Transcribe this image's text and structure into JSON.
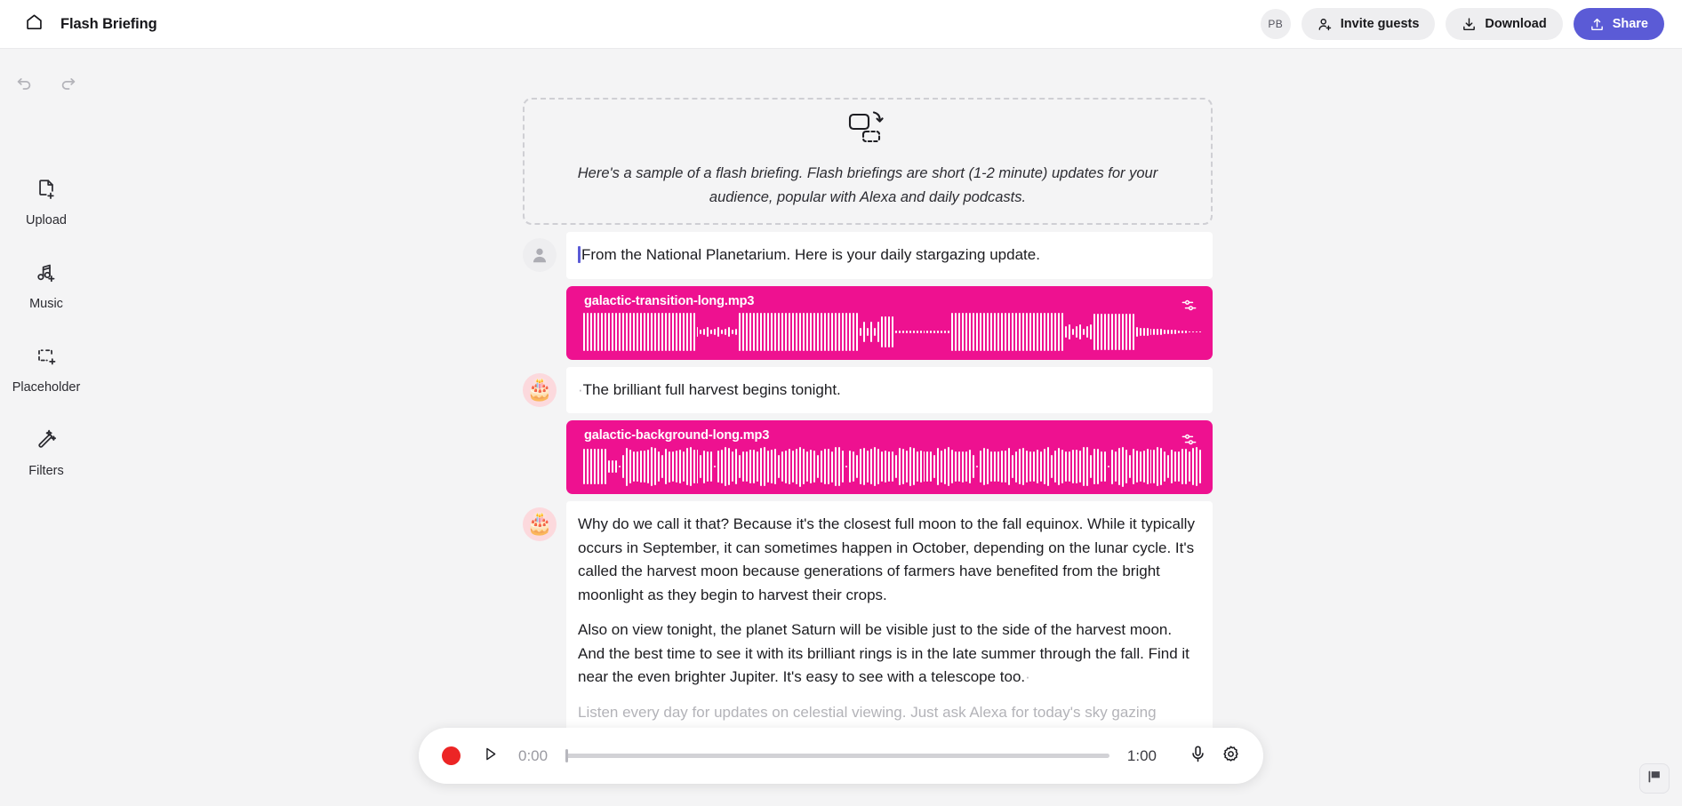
{
  "header": {
    "home_icon": "home-icon",
    "title": "Flash Briefing",
    "avatar_initials": "PB",
    "invite_label": "Invite guests",
    "download_label": "Download",
    "share_label": "Share",
    "accent_purple": "#5b5bd6"
  },
  "sidebar": {
    "undo_icon": "undo-icon",
    "redo_icon": "redo-icon",
    "items": [
      {
        "icon": "file-plus-icon",
        "label": "Upload"
      },
      {
        "icon": "music-note-plus-icon",
        "label": "Music"
      },
      {
        "icon": "dashed-box-plus-icon",
        "label": "Placeholder"
      },
      {
        "icon": "magic-wand-icon",
        "label": "Filters"
      }
    ]
  },
  "sample_card": {
    "icon": "duplicate-arrow-icon",
    "text": "Here's a sample of a flash briefing. Flash briefings are short (1-2 minute) updates for your audience, popular with Alexa and daily podcasts."
  },
  "transcript": {
    "row1": {
      "avatar": "person-avatar",
      "text": "From the National Planetarium. Here is your daily stargazing update."
    },
    "track1": {
      "name": "galactic-transition-long.mp3",
      "settings_icon": "sliders-icon",
      "color": "#ee1190"
    },
    "row2": {
      "avatar": "birthday-cake-emoji",
      "emoji": "🎂",
      "text": "The brilliant full harvest begins tonight."
    },
    "track2": {
      "name": "galactic-background-long.mp3",
      "settings_icon": "sliders-icon",
      "color": "#ee1190"
    },
    "row3": {
      "avatar": "birthday-cake-emoji",
      "emoji": "🎂",
      "paragraph1": "Why do we call it that? Because it's the closest full moon to the fall equinox. While it typically occurs in September, it can sometimes happen in October, depending on the lunar cycle. It's called the harvest moon because generations of farmers have benefited from the bright moonlight as they begin to harvest their crops.",
      "paragraph2": "Also on view tonight, the planet Saturn will be visible just to the side of the harvest moon. And the best time to see it with its brilliant rings is in the late summer through the fall. Find it near the even brighter Jupiter. It's easy to see with a telescope too.",
      "paragraph3": "Listen every day for updates on celestial viewing. Just ask Alexa for today's sky gazing update."
    }
  },
  "player": {
    "record_icon": "record-icon",
    "play_icon": "play-icon",
    "current_time": "0:00",
    "total_time": "1:00",
    "mic_icon": "microphone-icon",
    "settings_icon": "gear-icon",
    "record_color": "#ec2525"
  },
  "feedback": {
    "icon": "flag-icon"
  }
}
